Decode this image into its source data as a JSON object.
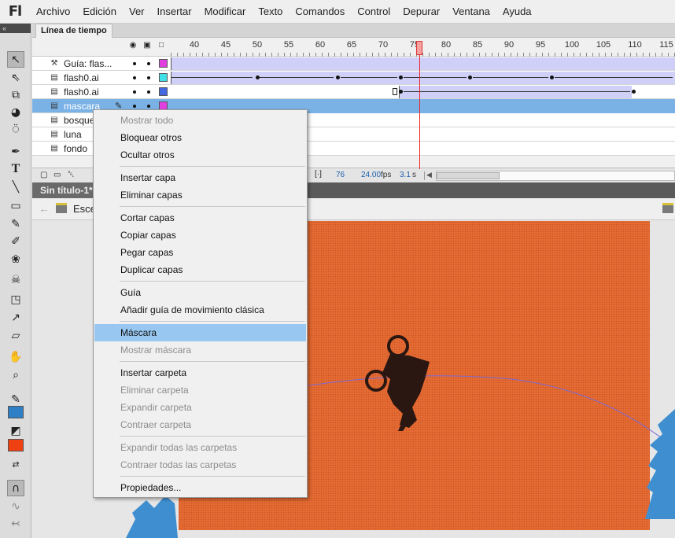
{
  "app": {
    "logo": "Fl"
  },
  "menubar": [
    "Archivo",
    "Edición",
    "Ver",
    "Insertar",
    "Modificar",
    "Texto",
    "Comandos",
    "Control",
    "Depurar",
    "Ventana",
    "Ayuda"
  ],
  "toolbar": {
    "collapse_glyph": "«"
  },
  "timeline": {
    "tab_label": "Línea de tiempo",
    "frame_numbers": [
      "40",
      "45",
      "50",
      "55",
      "60",
      "65",
      "70",
      "75",
      "80",
      "85",
      "90",
      "95",
      "100",
      "105",
      "110",
      "115"
    ],
    "layers": [
      {
        "name": "Guía: flas...",
        "color": "#e040e0",
        "selected": false
      },
      {
        "name": "flash0.ai",
        "color": "#40e0e8",
        "selected": false
      },
      {
        "name": "flash0.ai",
        "color": "#4466e0",
        "selected": false
      },
      {
        "name": "mascara",
        "color": "#e040e0",
        "selected": true
      },
      {
        "name": "bosque",
        "color": "",
        "selected": false
      },
      {
        "name": "luna",
        "color": "",
        "selected": false
      },
      {
        "name": "fondo",
        "color": "",
        "selected": false
      }
    ],
    "footer": {
      "current_frame": "76",
      "fps_value": "24.00",
      "fps_label": "fps",
      "time": "3.1",
      "time_unit": "s"
    }
  },
  "document": {
    "tab_label": "Sin título-1*",
    "scene_label": "Esce"
  },
  "context_menu": {
    "items": [
      {
        "label": "Mostrar todo",
        "disabled": true
      },
      {
        "label": "Bloquear otros",
        "disabled": false
      },
      {
        "label": "Ocultar otros",
        "disabled": false
      },
      {
        "label": "Insertar capa",
        "disabled": false
      },
      {
        "label": "Eliminar capas",
        "disabled": false
      },
      {
        "label": "Cortar capas",
        "disabled": false
      },
      {
        "label": "Copiar capas",
        "disabled": false
      },
      {
        "label": "Pegar capas",
        "disabled": false
      },
      {
        "label": "Duplicar capas",
        "disabled": false
      },
      {
        "label": "Guía",
        "disabled": false
      },
      {
        "label": "Añadir guía de movimiento clásica",
        "disabled": false
      },
      {
        "label": "Máscara",
        "disabled": false,
        "highlighted": true
      },
      {
        "label": "Mostrar máscara",
        "disabled": true
      },
      {
        "label": "Insertar carpeta",
        "disabled": false
      },
      {
        "label": "Eliminar carpeta",
        "disabled": true
      },
      {
        "label": "Expandir carpeta",
        "disabled": true
      },
      {
        "label": "Contraer carpeta",
        "disabled": true
      },
      {
        "label": "Expandir todas las carpetas",
        "disabled": true
      },
      {
        "label": "Contraer todas las carpetas",
        "disabled": true
      },
      {
        "label": "Propiedades...",
        "disabled": false
      }
    ]
  },
  "colors": {
    "stage": "#e36a32",
    "selection": "#7bb2e6",
    "menu_highlight": "#98c8f2",
    "playhead": "#e22222",
    "tree": "#3f8fd0"
  }
}
